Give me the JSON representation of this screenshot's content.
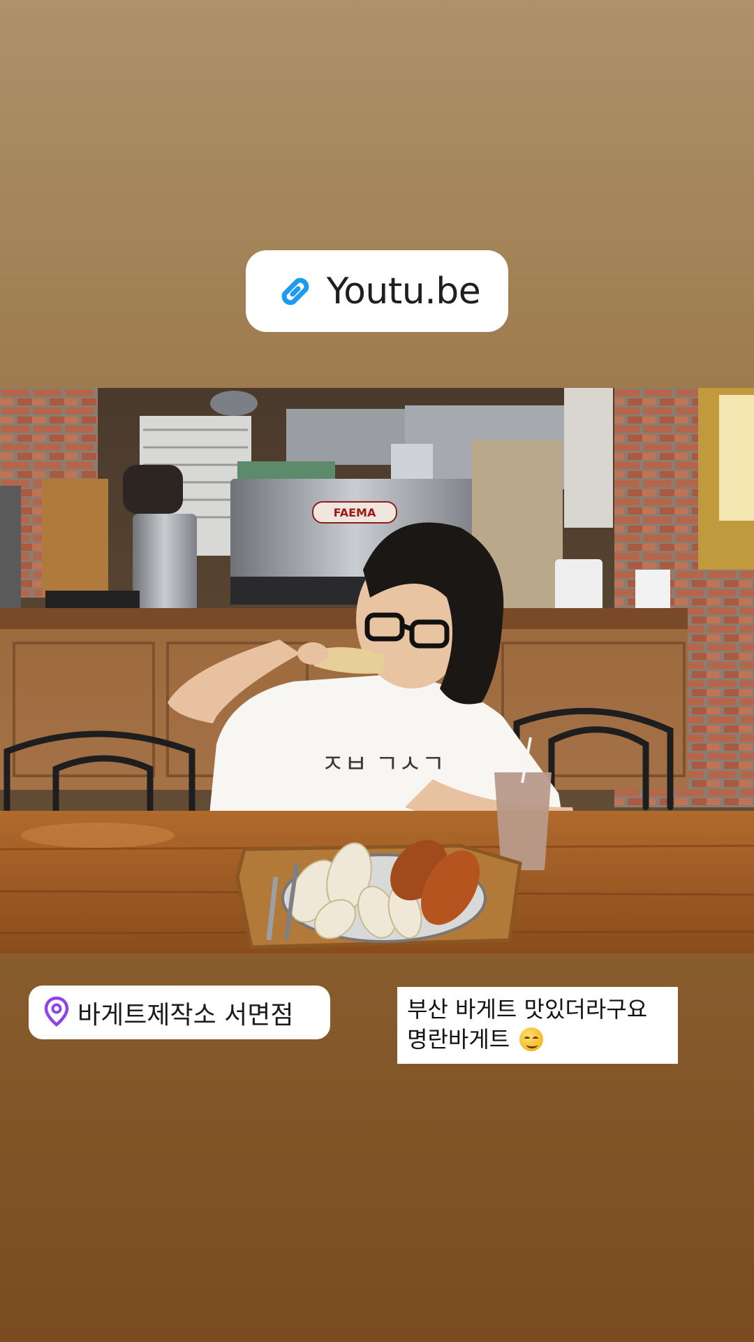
{
  "link_sticker": {
    "icon": "link-icon",
    "label": "Youtu.be"
  },
  "photo": {
    "description_icon": "story-photo",
    "machine_brand": "FAEMA"
  },
  "location_sticker": {
    "icon": "location-pin-icon",
    "label": "바게트제작소 서면점"
  },
  "caption": {
    "line1": "부산 바게트 맛있더라구요",
    "line2": "명란바게트",
    "emoji": "smirking-face-emoji"
  },
  "colors": {
    "link_icon": "#1d9bf0",
    "location_icon": "#8e44e8",
    "sticker_bg": "#ffffff"
  }
}
